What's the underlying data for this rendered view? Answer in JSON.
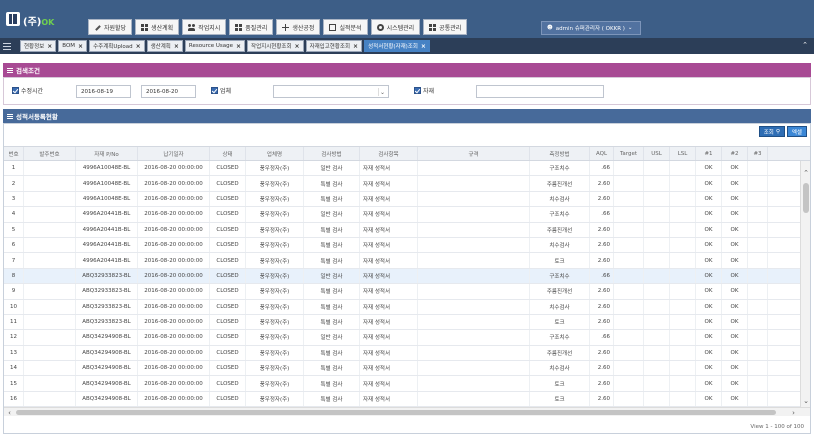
{
  "header": {
    "logo_text": "(주)",
    "logo_suffix": "OK",
    "menus": [
      {
        "label": "자원할당",
        "icon": "pen-icon"
      },
      {
        "label": "생산계획",
        "icon": "grid-icon"
      },
      {
        "label": "작업지시",
        "icon": "people-icon"
      },
      {
        "label": "품질관리",
        "icon": "grid-icon"
      },
      {
        "label": "생산공정",
        "icon": "cross-icon"
      },
      {
        "label": "실적분석",
        "icon": "chart-icon"
      },
      {
        "label": "시스템관리",
        "icon": "gear-icon"
      },
      {
        "label": "공통관리",
        "icon": "grid-icon"
      }
    ],
    "user_label": "admin 슈퍼관리자 ( OKKR )"
  },
  "tabs": [
    {
      "label": "현황정보",
      "active": false
    },
    {
      "label": "BOM",
      "active": false
    },
    {
      "label": "수주계획Upload",
      "active": false
    },
    {
      "label": "생산계획",
      "active": false
    },
    {
      "label": "Resource Usage",
      "active": false
    },
    {
      "label": "작업지시현황조회",
      "active": false
    },
    {
      "label": "자재입고현황조회",
      "active": false
    },
    {
      "label": "성적서현황(자재)조회",
      "active": true
    }
  ],
  "search": {
    "title": "검색조건",
    "date_label": "수정시간",
    "date_from": "2016-08-19",
    "date_to": "2016-08-20",
    "vendor_label": "업체",
    "vendor_value": "",
    "material_label": "자재",
    "material_value": ""
  },
  "list": {
    "title": "성적서등록현황",
    "search_button": "조회",
    "excel_button": "엑셀",
    "columns": [
      "번호",
      "발주번호",
      "자재 P/No",
      "납기일자",
      "상태",
      "업체명",
      "검사방법",
      "검사항목",
      "규격",
      "측정방법",
      "AQL",
      "Target",
      "USL",
      "LSL",
      "#1",
      "#2",
      "#3"
    ],
    "rows": [
      [
        "1",
        "",
        "4996A10048E-BL",
        "2016-08-20 00:00:00",
        "CLOSED",
        "풍우정자(주)",
        "일반 검사",
        "자재 성적서",
        "",
        "구조치수",
        ".66",
        "",
        "",
        "",
        "OK",
        "OK",
        ""
      ],
      [
        "2",
        "",
        "4996A10048E-BL",
        "2016-08-20 00:00:00",
        "CLOSED",
        "풍우정자(주)",
        "특별 검사",
        "자재 성적서",
        "",
        "주름진개선",
        "2.60",
        "",
        "",
        "",
        "OK",
        "OK",
        ""
      ],
      [
        "3",
        "",
        "4996A10048E-BL",
        "2016-08-20 00:00:00",
        "CLOSED",
        "풍우정자(주)",
        "특별 검사",
        "자재 성적서",
        "",
        "치수검사",
        "2.60",
        "",
        "",
        "",
        "OK",
        "OK",
        ""
      ],
      [
        "4",
        "",
        "4996A20441B-BL",
        "2016-08-20 00:00:00",
        "CLOSED",
        "풍우정자(주)",
        "일반 검사",
        "자재 성적서",
        "",
        "구조치수",
        ".66",
        "",
        "",
        "",
        "OK",
        "OK",
        ""
      ],
      [
        "5",
        "",
        "4996A20441B-BL",
        "2016-08-20 00:00:00",
        "CLOSED",
        "풍우정자(주)",
        "특별 검사",
        "자재 성적서",
        "",
        "주름진개선",
        "2.60",
        "",
        "",
        "",
        "OK",
        "OK",
        ""
      ],
      [
        "6",
        "",
        "4996A20441B-BL",
        "2016-08-20 00:00:00",
        "CLOSED",
        "풍우정자(주)",
        "특별 검사",
        "자재 성적서",
        "",
        "치수검사",
        "2.60",
        "",
        "",
        "",
        "OK",
        "OK",
        ""
      ],
      [
        "7",
        "",
        "4996A20441B-BL",
        "2016-08-20 00:00:00",
        "CLOSED",
        "풍우정자(주)",
        "특별 검사",
        "자재 성적서",
        "",
        "토크",
        "2.60",
        "",
        "",
        "",
        "OK",
        "OK",
        ""
      ],
      [
        "8",
        "",
        "ABQ32933823-BL",
        "2016-08-20 00:00:00",
        "CLOSED",
        "풍우정자(주)",
        "일반 검사",
        "자재 성적서",
        "",
        "구조치수",
        ".66",
        "",
        "",
        "",
        "OK",
        "OK",
        ""
      ],
      [
        "9",
        "",
        "ABQ32933823-BL",
        "2016-08-20 00:00:00",
        "CLOSED",
        "풍우정자(주)",
        "특별 검사",
        "자재 성적서",
        "",
        "주름진개선",
        "2.60",
        "",
        "",
        "",
        "OK",
        "OK",
        ""
      ],
      [
        "10",
        "",
        "ABQ32933823-BL",
        "2016-08-20 00:00:00",
        "CLOSED",
        "풍우정자(주)",
        "특별 검사",
        "자재 성적서",
        "",
        "치수검사",
        "2.60",
        "",
        "",
        "",
        "OK",
        "OK",
        ""
      ],
      [
        "11",
        "",
        "ABQ32933823-BL",
        "2016-08-20 00:00:00",
        "CLOSED",
        "풍우정자(주)",
        "특별 검사",
        "자재 성적서",
        "",
        "토크",
        "2.60",
        "",
        "",
        "",
        "OK",
        "OK",
        ""
      ],
      [
        "12",
        "",
        "ABQ34294908-BL",
        "2016-08-20 00:00:00",
        "CLOSED",
        "풍우정자(주)",
        "일반 검사",
        "자재 성적서",
        "",
        "구조치수",
        ".66",
        "",
        "",
        "",
        "OK",
        "OK",
        ""
      ],
      [
        "13",
        "",
        "ABQ34294908-BL",
        "2016-08-20 00:00:00",
        "CLOSED",
        "풍우정자(주)",
        "특별 검사",
        "자재 성적서",
        "",
        "주름진개선",
        "2.60",
        "",
        "",
        "",
        "OK",
        "OK",
        ""
      ],
      [
        "14",
        "",
        "ABQ34294908-BL",
        "2016-08-20 00:00:00",
        "CLOSED",
        "풍우정자(주)",
        "특별 검사",
        "자재 성적서",
        "",
        "치수검사",
        "2.60",
        "",
        "",
        "",
        "OK",
        "OK",
        ""
      ],
      [
        "15",
        "",
        "ABQ34294908-BL",
        "2016-08-20 00:00:00",
        "CLOSED",
        "풍우정자(주)",
        "특별 검사",
        "자재 성적서",
        "",
        "토크",
        "2.60",
        "",
        "",
        "",
        "OK",
        "OK",
        ""
      ],
      [
        "16",
        "",
        "ABQ34294908-BL",
        "2016-08-20 00:00:00",
        "CLOSED",
        "풍우정자(주)",
        "특별 검사",
        "자재 성적서",
        "",
        "토크",
        "2.60",
        "",
        "",
        "",
        "OK",
        "OK",
        ""
      ]
    ],
    "selected_row": 7,
    "pager_text": "View 1 - 100 of 100"
  },
  "colors": {
    "topbar": "#3d5e87",
    "tabsbar": "#2c3e58",
    "active_tab": "#4682c4",
    "search_header": "#a84a94",
    "list_header": "#476a9a",
    "button": "#2e6db4"
  }
}
